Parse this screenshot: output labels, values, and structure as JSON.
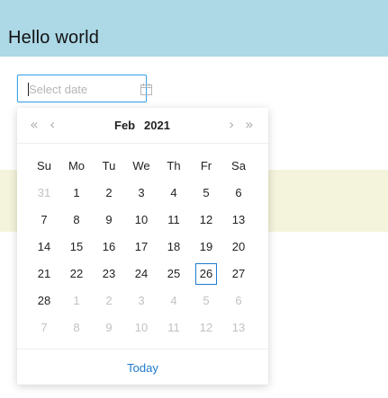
{
  "header": {
    "title": "Hello world",
    "background": "#add8e6"
  },
  "date_input": {
    "placeholder": "Select date",
    "value": "",
    "icon": "calendar-icon",
    "border_color": "#42a5e6"
  },
  "calendar": {
    "month_label": "Feb",
    "year_label": "2021",
    "nav": {
      "prev_year": "«",
      "prev_month": "‹",
      "next_month": "›",
      "next_year": "»"
    },
    "weekdays": [
      "Su",
      "Mo",
      "Tu",
      "We",
      "Th",
      "Fr",
      "Sa"
    ],
    "weeks": [
      [
        {
          "d": "31",
          "o": true
        },
        {
          "d": "1"
        },
        {
          "d": "2"
        },
        {
          "d": "3"
        },
        {
          "d": "4"
        },
        {
          "d": "5"
        },
        {
          "d": "6"
        }
      ],
      [
        {
          "d": "7"
        },
        {
          "d": "8"
        },
        {
          "d": "9"
        },
        {
          "d": "10"
        },
        {
          "d": "11"
        },
        {
          "d": "12"
        },
        {
          "d": "13"
        }
      ],
      [
        {
          "d": "14"
        },
        {
          "d": "15"
        },
        {
          "d": "16"
        },
        {
          "d": "17"
        },
        {
          "d": "18"
        },
        {
          "d": "19"
        },
        {
          "d": "20"
        }
      ],
      [
        {
          "d": "21"
        },
        {
          "d": "22"
        },
        {
          "d": "23"
        },
        {
          "d": "24"
        },
        {
          "d": "25"
        },
        {
          "d": "26",
          "t": true
        },
        {
          "d": "27"
        }
      ],
      [
        {
          "d": "28"
        },
        {
          "d": "1",
          "o": true
        },
        {
          "d": "2",
          "o": true
        },
        {
          "d": "3",
          "o": true
        },
        {
          "d": "4",
          "o": true
        },
        {
          "d": "5",
          "o": true
        },
        {
          "d": "6",
          "o": true
        }
      ],
      [
        {
          "d": "7",
          "o": true
        },
        {
          "d": "8",
          "o": true
        },
        {
          "d": "9",
          "o": true
        },
        {
          "d": "10",
          "o": true
        },
        {
          "d": "11",
          "o": true
        },
        {
          "d": "12",
          "o": true
        },
        {
          "d": "13",
          "o": true
        }
      ]
    ],
    "today_button": "Today",
    "accent_color": "#1e7bd0"
  },
  "stripe": {
    "background": "#f4f4dc"
  }
}
